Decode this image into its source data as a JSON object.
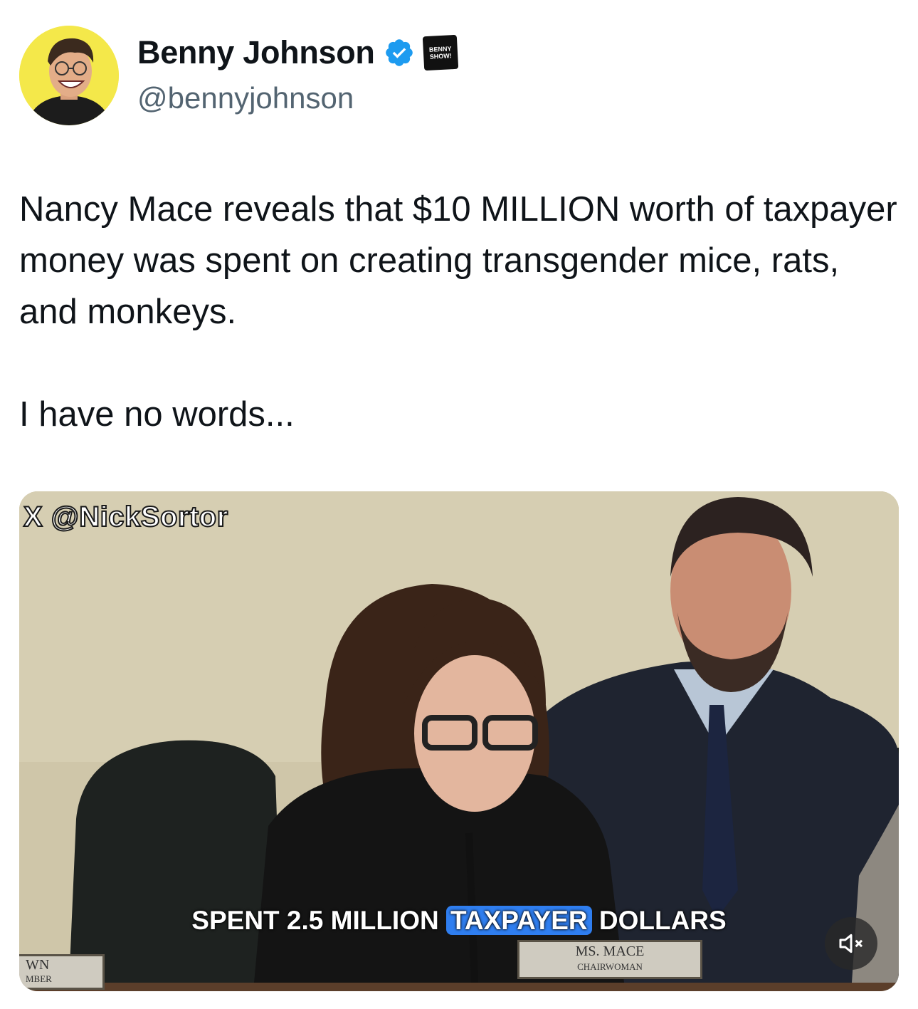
{
  "user": {
    "display_name": "Benny Johnson",
    "handle": "@bennyjohnson",
    "verified_icon": "verified-badge-icon",
    "affiliate_badge": "BENNY SHOW!"
  },
  "tweet": {
    "paragraphs": [
      "Nancy Mace reveals that $10 MILLION worth of taxpayer money was spent on creating transgender mice, rats, and monkeys.",
      "I have no words..."
    ]
  },
  "media": {
    "watermark": "X @NickSortor",
    "caption_before": "SPENT 2.5 MILLION ",
    "caption_highlight": "TAXPAYER",
    "caption_after": " DOLLARS",
    "nameplate_line1": "MS. MACE",
    "nameplate_line2": "CHAIRWOMAN",
    "nameplate_left_line1": "WN",
    "nameplate_left_line2": "MBER",
    "mute_icon": "volume-muted-icon"
  },
  "colors": {
    "text": "#0f1419",
    "secondary_text": "#536471",
    "verified_blue": "#1d9bf0",
    "caption_highlight": "#2f7ef0",
    "avatar_bg": "#f4e84a"
  }
}
